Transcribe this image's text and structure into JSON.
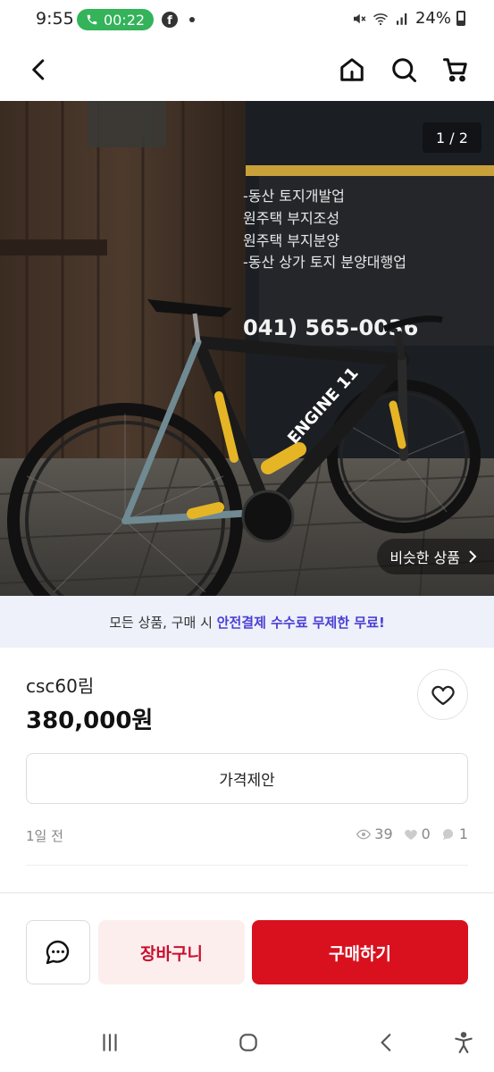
{
  "status_bar": {
    "time": "9:55",
    "call_timer": "00:22",
    "facebook_glyph": "f",
    "battery": "24%",
    "call_color": "#34b35a"
  },
  "header": {
    "back_icon": "chevron-left",
    "home_icon": "home",
    "search_icon": "search",
    "cart_icon": "shopping-cart"
  },
  "hero": {
    "page_indicator": "1 / 2",
    "similar_label": "비슷한 상품",
    "sign_lines": [
      "-동산 토지개발업",
      "원주택 부지조성",
      "원주택 부지분양",
      "-동산 상가 토지 분양대행업"
    ],
    "sign_phone": "041) 565-0036",
    "frame_brand": "ENGINE 11"
  },
  "banner": {
    "text_prefix": "모든 상품, 구매 시 ",
    "text_highlight": "안전결제 수수료 무제한 무료!",
    "highlight_color": "#4a3fd4"
  },
  "product": {
    "title": "csc60림",
    "price": "380,000원",
    "offer_label": "가격제안",
    "posted": "1일 전",
    "views": "39",
    "likes": "0",
    "chats": "1"
  },
  "actions": {
    "chat_icon": "chat-bubble",
    "cart_label": "장바구니",
    "buy_label": "구매하기",
    "buy_color": "#d9111f"
  },
  "nav": {
    "recents_icon": "recents",
    "home_icon": "home-circle",
    "back_icon": "back",
    "accessibility_icon": "accessibility"
  }
}
